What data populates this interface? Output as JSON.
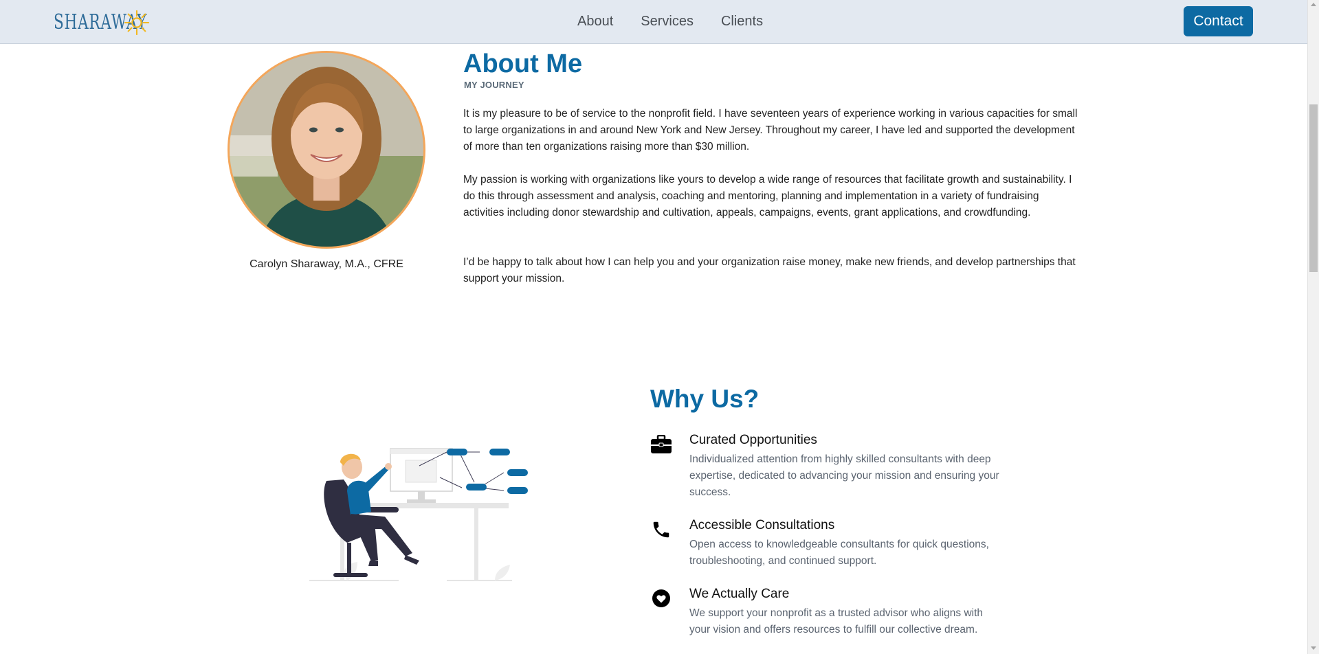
{
  "header": {
    "logo_text": "SHARAWAY",
    "nav": [
      "About",
      "Services",
      "Clients"
    ],
    "contact_label": "Contact",
    "brand_color": "#0d6aa3"
  },
  "about": {
    "title": "About Me",
    "subtitle": "MY JOURNEY",
    "person_name": "Carolyn Sharaway, M.A., CFRE",
    "paragraphs": [
      "It is my pleasure to be of service to the nonprofit field. I have seventeen years of experience working in various capacities for small to large organizations in and around New York and New Jersey. Throughout my career, I have led and supported the development of more than ten organizations raising more than $30 million.",
      "My passion is working with organizations like yours to develop a wide range of resources that facilitate growth and sustainability. I do this through assessment and analysis, coaching and mentoring, planning and implementation in a variety of fundraising activities including donor stewardship and cultivation, appeals, campaigns, events, grant applications, and crowdfunding.",
      "I’d be happy to talk about how I can help you and your organization raise money, make new friends, and develop partnerships that support your mission."
    ]
  },
  "why_us": {
    "title": "Why Us?",
    "features": [
      {
        "icon": "briefcase-icon",
        "title": "Curated Opportunities",
        "desc": "Individualized attention from highly skilled consultants with deep expertise, dedicated to advancing your mission and ensuring your success."
      },
      {
        "icon": "phone-icon",
        "title": "Accessible Consultations",
        "desc": "Open access to knowledgeable consultants for quick questions, troubleshooting, and continued support."
      },
      {
        "icon": "heart-icon",
        "title": "We Actually Care",
        "desc": "We support your nonprofit as a trusted advisor who aligns with your vision and offers resources to fulfill our collective dream."
      }
    ]
  }
}
